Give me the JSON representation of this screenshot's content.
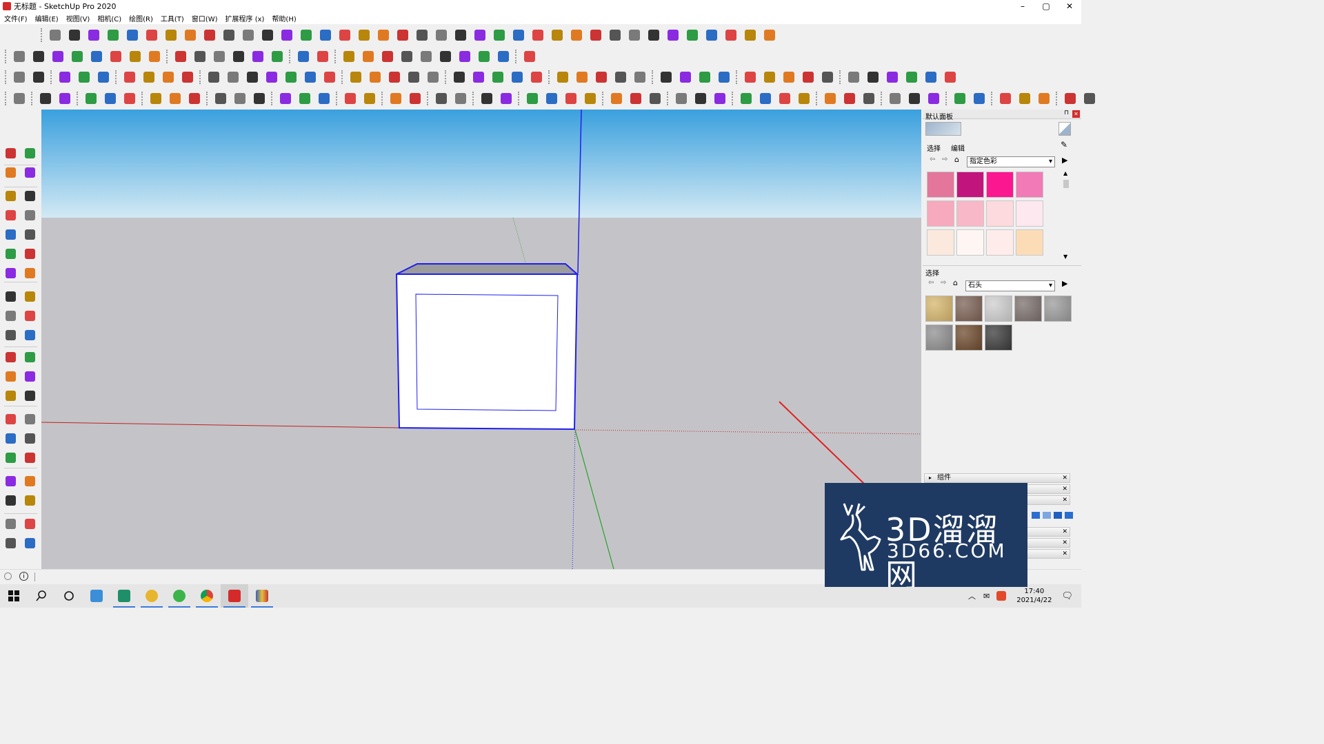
{
  "window": {
    "title": "无标题 - SketchUp Pro 2020",
    "minimize": "–",
    "maximize": "▢",
    "close": "✕"
  },
  "menu": [
    "文件(F)",
    "编辑(E)",
    "视图(V)",
    "相机(C)",
    "绘图(R)",
    "工具(T)",
    "窗口(W)",
    "扩展程序 (x)",
    "帮助(H)"
  ],
  "panel": {
    "title": "默认面板",
    "tab_select": "选择",
    "tab_edit": "编辑",
    "colors_dropdown": "指定色彩",
    "swatches": [
      "#e3769a",
      "#c2147d",
      "#fb1790",
      "#f27ab6",
      "#f7a9bd",
      "#f8b8c8",
      "#fddadd",
      "#fde8ef",
      "#fbe9de",
      "#fdf6f3",
      "#fdecea",
      "#fcdcb7"
    ],
    "lower_label": "选择",
    "materials_dropdown": "石头",
    "stones": [
      "#d6b66c",
      "#7c6155",
      "#cfcfcf",
      "#7b706c",
      "#9b9b9b",
      "#8f8f8f",
      "#6e4a2e",
      "#3a3a3a"
    ],
    "tray_components": "组件"
  },
  "watermark": {
    "cn": "3D溜溜网",
    "en": "3D66.COM"
  },
  "taskbar": {
    "time": "17:40",
    "date": "2021/4/22"
  }
}
